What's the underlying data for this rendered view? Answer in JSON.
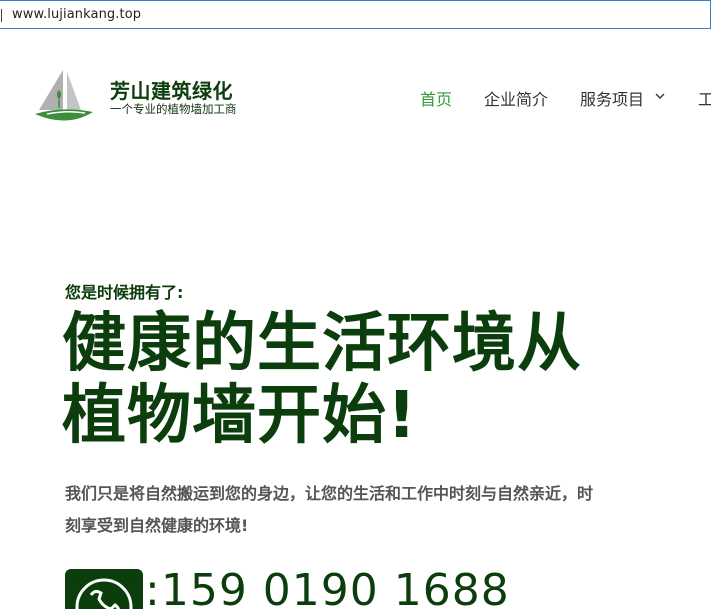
{
  "browser": {
    "url": "www.lujiankang.top"
  },
  "header": {
    "brand_name": "芳山建筑绿化",
    "brand_tagline": "一个专业的植物墙加工商",
    "nav": {
      "home": "首页",
      "about": "企业简介",
      "services": "服务项目",
      "more": "工"
    }
  },
  "hero": {
    "kicker": "您是时候拥有了:",
    "headline_line1": "健康的生活环境从",
    "headline_line2": "植物墙开始!",
    "description": "我们只是将自然搬运到您的身边，让您的生活和工作中时刻与自然亲近，时刻享受到自然健康的环境!",
    "phone_prefix": ":",
    "phone_number": "159 0190 1688"
  },
  "colors": {
    "brand_dark_green": "#0c3d0c",
    "nav_active": "#2e9e3c",
    "address_border": "#3c7fc7"
  },
  "icons": {
    "logo": "sailboat-leaf-logo",
    "services_dropdown": "chevron-down-icon",
    "phone": "phone-icon"
  }
}
